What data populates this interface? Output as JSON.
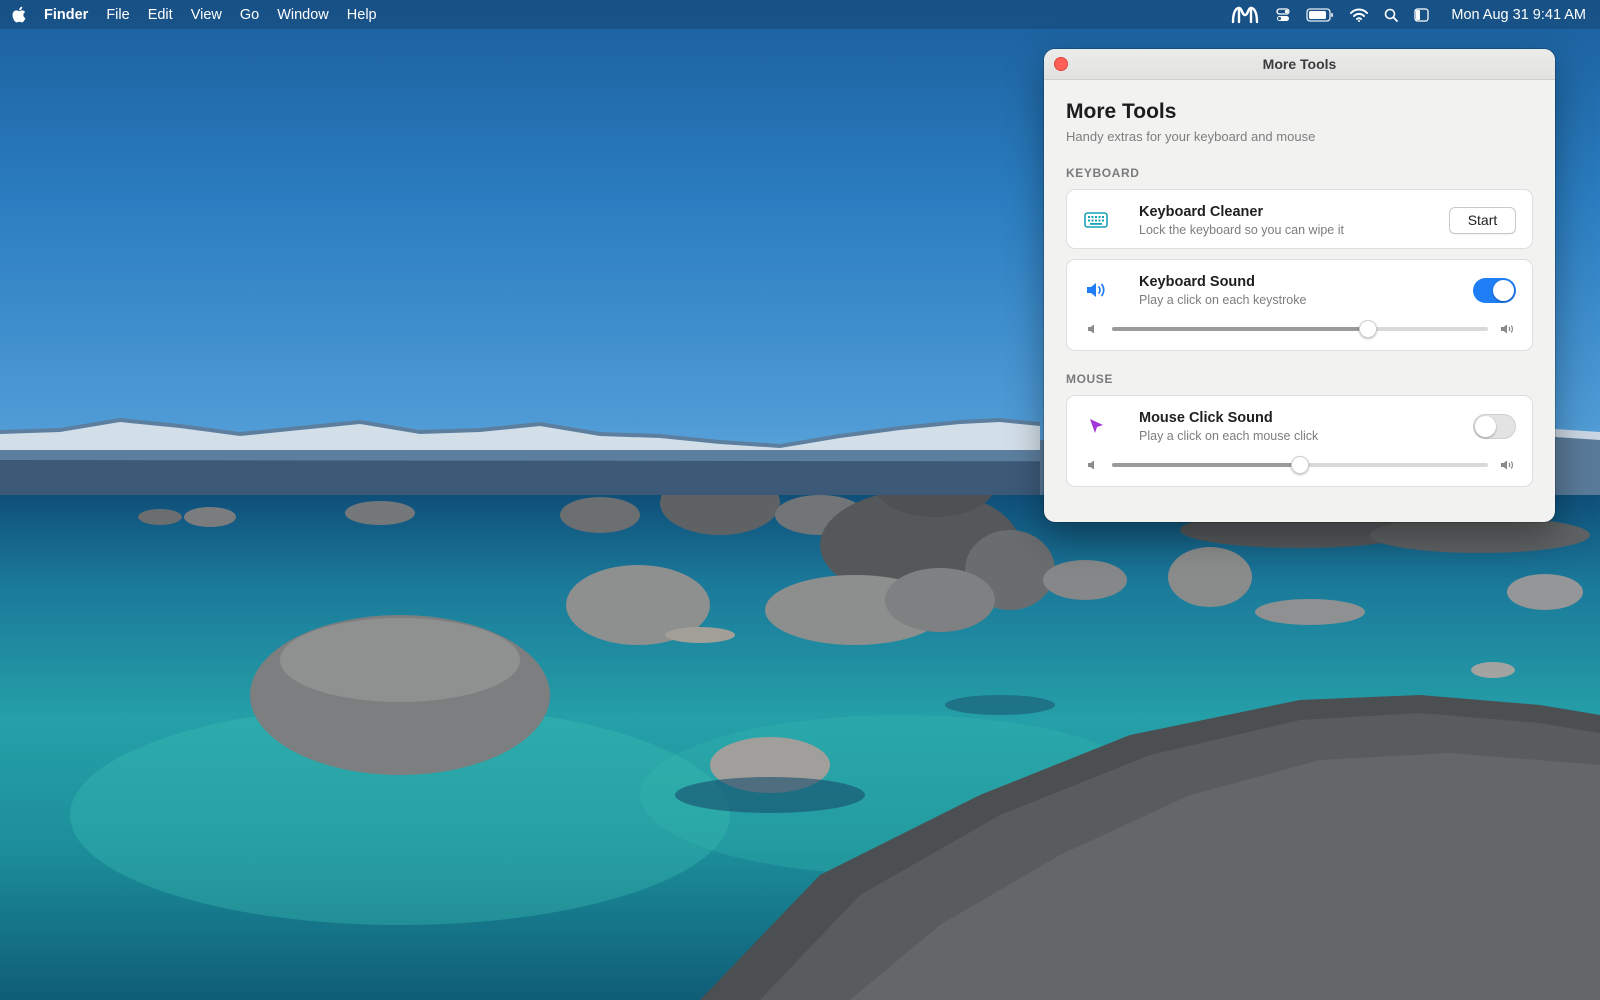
{
  "menubar": {
    "app_name": "Finder",
    "items": [
      {
        "label": "File"
      },
      {
        "label": "Edit"
      },
      {
        "label": "View"
      },
      {
        "label": "Go"
      },
      {
        "label": "Window"
      },
      {
        "label": "Help"
      }
    ],
    "status_icons": [
      "m-logo-icon",
      "control-center-toggle-icon",
      "battery-icon",
      "wifi-icon",
      "spotlight-search-icon",
      "sidebar-icon"
    ],
    "clock": "Mon Aug 31  9:41 AM"
  },
  "window": {
    "title": "More Tools",
    "header": {
      "title": "More Tools",
      "subtitle": "Handy extras for your keyboard and mouse"
    },
    "sections": {
      "keyboard": {
        "label": "KEYBOARD",
        "cleaner": {
          "icon": "keyboard-icon",
          "title": "Keyboard Cleaner",
          "description": "Lock the keyboard so you can wipe it",
          "button_label": "Start"
        },
        "sound": {
          "icon": "speaker-icon",
          "title": "Keyboard Sound",
          "description": "Play a click on each keystroke",
          "enabled": true,
          "volume": 0.68
        }
      },
      "mouse": {
        "label": "MOUSE",
        "click_sound": {
          "icon": "cursor-arrow-icon",
          "title": "Mouse Click Sound",
          "description": "Play a click on each mouse click",
          "enabled": false,
          "volume": 0.5
        }
      }
    }
  },
  "colors": {
    "accent": "#1f7ef5",
    "close_button": "#ff5f57",
    "keyboard_icon": "#1aa4b8",
    "speaker_icon": "#1f7ef5",
    "cursor_icon": "#a236d6"
  }
}
